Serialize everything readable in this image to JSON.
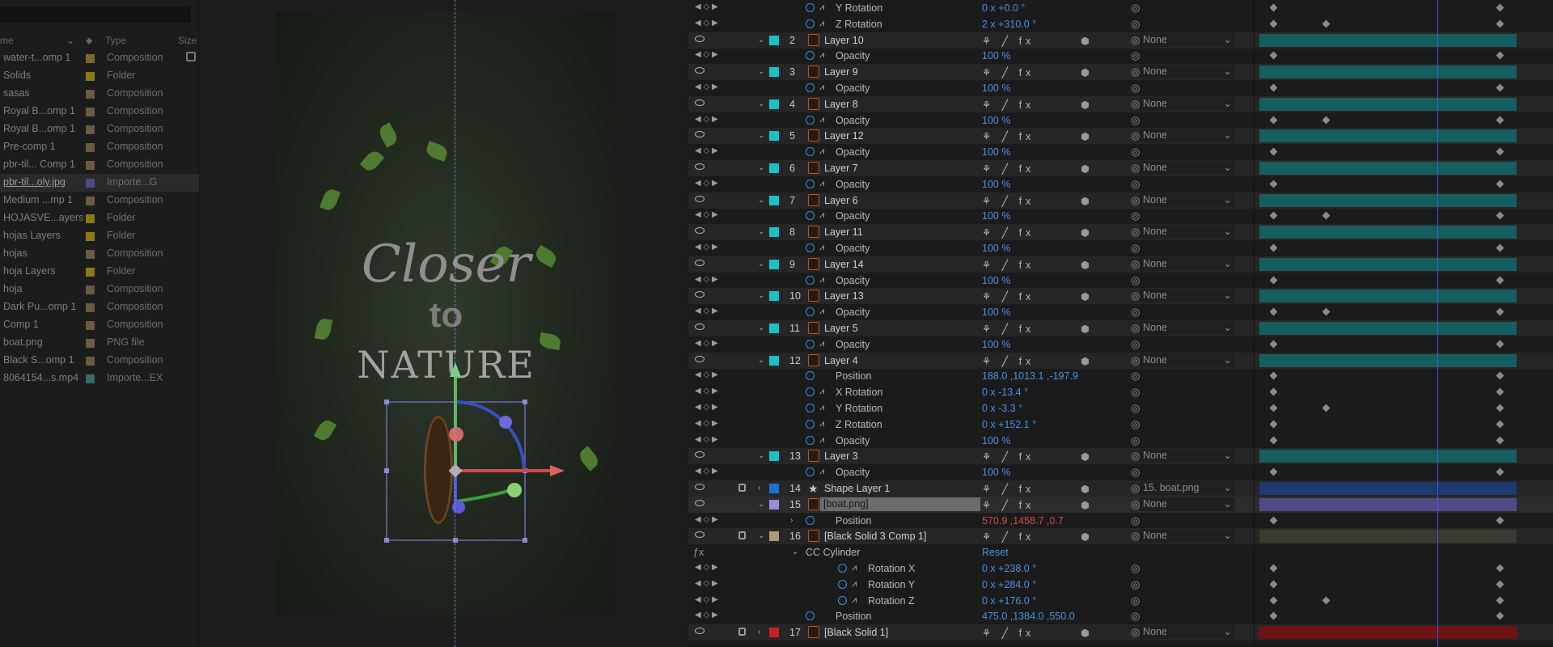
{
  "project": {
    "columns": {
      "name": "me",
      "type": "Type",
      "size": "Size"
    },
    "items": [
      {
        "name": "water-t...omp 1",
        "type": "Composition",
        "color": "#7a6a2a"
      },
      {
        "name": "Solids",
        "type": "Folder",
        "color": "#8a7a10"
      },
      {
        "name": "sasas",
        "type": "Composition",
        "color": "#6a5a40"
      },
      {
        "name": "Royal B...omp 1",
        "type": "Composition",
        "color": "#6a5a40"
      },
      {
        "name": "Royal B...omp 1",
        "type": "Composition",
        "color": "#6a5a40"
      },
      {
        "name": "Pre-comp 1",
        "type": "Composition",
        "color": "#6a5a40"
      },
      {
        "name": "pbr-til... Comp 1",
        "type": "Composition",
        "color": "#6a5a40"
      },
      {
        "name": "pbr-til...oly.jpg",
        "type": "Importe...G",
        "color": "#4a4a8a",
        "selected": true
      },
      {
        "name": "Medium ...mp 1",
        "type": "Composition",
        "color": "#6a5a40"
      },
      {
        "name": "HOJASVE...ayers",
        "type": "Folder",
        "color": "#8a7a10"
      },
      {
        "name": "hojas Layers",
        "type": "Folder",
        "color": "#8a7a10"
      },
      {
        "name": "hojas",
        "type": "Composition",
        "color": "#6a5a40"
      },
      {
        "name": "hoja Layers",
        "type": "Folder",
        "color": "#8a7a10"
      },
      {
        "name": "hoja",
        "type": "Composition",
        "color": "#6a5a40"
      },
      {
        "name": "Dark Pu...omp 1",
        "type": "Composition",
        "color": "#6a5a40"
      },
      {
        "name": "Comp 1",
        "type": "Composition",
        "color": "#6a5a40"
      },
      {
        "name": "boat.png",
        "type": "PNG file",
        "color": "#6a5a40"
      },
      {
        "name": "Black S...omp 1",
        "type": "Composition",
        "color": "#6a5a40"
      },
      {
        "name": "8064154...s.mp4",
        "type": "Importe...EX",
        "color": "#3a6a6a"
      }
    ]
  },
  "comp": {
    "title_line1": "Closer",
    "title_line2": "to",
    "title_line3": "NATURE"
  },
  "timeline": {
    "rows": [
      {
        "kind": "prop",
        "indent": 1,
        "name": "Y Rotation",
        "value": "0 x +0.0 °",
        "graph": true
      },
      {
        "kind": "prop",
        "indent": 1,
        "name": "Z Rotation",
        "value": "2 x +310.0 °",
        "graph": true
      },
      {
        "kind": "layer",
        "num": "2",
        "name": "Layer 10",
        "parent": "None",
        "label": "#17c3c8",
        "bar": "#145e5e"
      },
      {
        "kind": "prop",
        "indent": 1,
        "name": "Opacity",
        "value": "100 %",
        "graph": true
      },
      {
        "kind": "layer",
        "num": "3",
        "name": "Layer 9",
        "parent": "None",
        "label": "#17c3c8",
        "bar": "#145e5e"
      },
      {
        "kind": "prop",
        "indent": 1,
        "name": "Opacity",
        "value": "100 %",
        "graph": true
      },
      {
        "kind": "layer",
        "num": "4",
        "name": "Layer 8",
        "parent": "None",
        "label": "#17c3c8",
        "bar": "#145e5e"
      },
      {
        "kind": "prop",
        "indent": 1,
        "name": "Opacity",
        "value": "100 %",
        "graph": true
      },
      {
        "kind": "layer",
        "num": "5",
        "name": "Layer 12",
        "parent": "None",
        "label": "#17c3c8",
        "bar": "#145e5e"
      },
      {
        "kind": "prop",
        "indent": 1,
        "name": "Opacity",
        "value": "100 %",
        "graph": true
      },
      {
        "kind": "layer",
        "num": "6",
        "name": "Layer 7",
        "parent": "None",
        "label": "#17c3c8",
        "bar": "#145e5e"
      },
      {
        "kind": "prop",
        "indent": 1,
        "name": "Opacity",
        "value": "100 %",
        "graph": true
      },
      {
        "kind": "layer",
        "num": "7",
        "name": "Layer 6",
        "parent": "None",
        "label": "#17c3c8",
        "bar": "#145e5e"
      },
      {
        "kind": "prop",
        "indent": 1,
        "name": "Opacity",
        "value": "100 %",
        "graph": true
      },
      {
        "kind": "layer",
        "num": "8",
        "name": "Layer 11",
        "parent": "None",
        "label": "#17c3c8",
        "bar": "#145e5e"
      },
      {
        "kind": "prop",
        "indent": 1,
        "name": "Opacity",
        "value": "100 %",
        "graph": true
      },
      {
        "kind": "layer",
        "num": "9",
        "name": "Layer 14",
        "parent": "None",
        "label": "#17c3c8",
        "bar": "#145e5e"
      },
      {
        "kind": "prop",
        "indent": 1,
        "name": "Opacity",
        "value": "100 %",
        "graph": true
      },
      {
        "kind": "layer",
        "num": "10",
        "name": "Layer 13",
        "parent": "None",
        "label": "#17c3c8",
        "bar": "#145e5e"
      },
      {
        "kind": "prop",
        "indent": 1,
        "name": "Opacity",
        "value": "100 %",
        "graph": true
      },
      {
        "kind": "layer",
        "num": "11",
        "name": "Layer 5",
        "parent": "None",
        "label": "#17c3c8",
        "bar": "#145e5e"
      },
      {
        "kind": "prop",
        "indent": 1,
        "name": "Opacity",
        "value": "100 %",
        "graph": true
      },
      {
        "kind": "layer",
        "num": "12",
        "name": "Layer 4",
        "parent": "None",
        "label": "#17c3c8",
        "bar": "#145e5e"
      },
      {
        "kind": "prop",
        "indent": 1,
        "name": "Position",
        "value": "188.0 ,1013.1 ,-197.9",
        "graph": false
      },
      {
        "kind": "prop",
        "indent": 1,
        "name": "X Rotation",
        "value": "0 x -13.4 °",
        "graph": true
      },
      {
        "kind": "prop",
        "indent": 1,
        "name": "Y Rotation",
        "value": "0 x -3.3 °",
        "graph": true
      },
      {
        "kind": "prop",
        "indent": 1,
        "name": "Z Rotation",
        "value": "0 x +152.1 °",
        "graph": true
      },
      {
        "kind": "prop",
        "indent": 1,
        "name": "Opacity",
        "value": "100 %",
        "graph": true
      },
      {
        "kind": "layer",
        "num": "13",
        "name": "Layer 3",
        "parent": "None",
        "label": "#17c3c8",
        "bar": "#145e5e"
      },
      {
        "kind": "prop",
        "indent": 1,
        "name": "Opacity",
        "value": "100 %",
        "graph": true
      },
      {
        "kind": "layer",
        "num": "14",
        "name": "Shape Layer 1",
        "parent": "15. boat.png",
        "label": "#1e6ed8",
        "bar": "#1c3a6e",
        "locked": true,
        "star": true,
        "collapsed": true
      },
      {
        "kind": "layer",
        "num": "15",
        "name": "[boat.png]",
        "parent": "None",
        "label": "#9b8ad6",
        "bar": "#4e4a86",
        "selected": true,
        "boxed": true
      },
      {
        "kind": "prop",
        "indent": 1,
        "name": "Position",
        "value": "570.9 ,1458.7 ,0.7",
        "graph": false,
        "red": true,
        "twirl": true
      },
      {
        "kind": "layer",
        "num": "16",
        "name": "[Black Solid 3 Comp 1]",
        "parent": "None",
        "label": "#a89a72",
        "bar": "#3a3a2e",
        "locked": true
      },
      {
        "kind": "effect",
        "name": "CC Cylinder",
        "value": "Reset"
      },
      {
        "kind": "prop",
        "indent": 2,
        "name": "Rotation X",
        "value": "0 x +238.0 °",
        "graph": true
      },
      {
        "kind": "prop",
        "indent": 2,
        "name": "Rotation Y",
        "value": "0 x +284.0 °",
        "graph": true
      },
      {
        "kind": "prop",
        "indent": 2,
        "name": "Rotation Z",
        "value": "0 x +176.0 °",
        "graph": true
      },
      {
        "kind": "prop",
        "indent": 1,
        "name": "Position",
        "value": "475.0 ,1384.0 ,550.0",
        "graph": false
      },
      {
        "kind": "layer",
        "num": "17",
        "name": "[Black Solid 1]",
        "parent": "None",
        "label": "#c42020",
        "bar": "#6e1414",
        "locked": true,
        "collapsed": true
      }
    ]
  }
}
